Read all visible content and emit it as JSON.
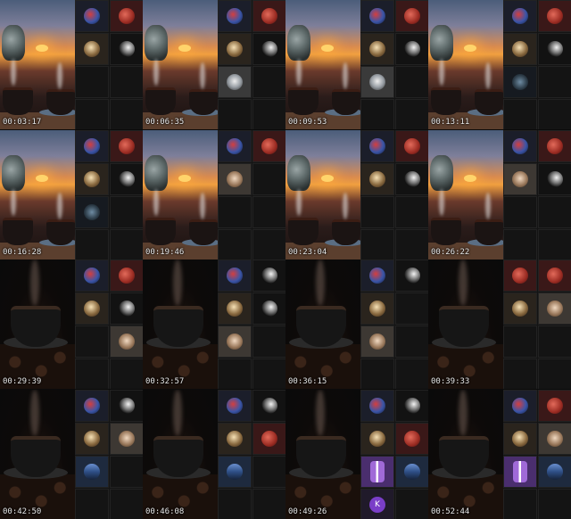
{
  "frames": [
    {
      "timestamp": "00:03:17",
      "scene": "sunset",
      "tiles": [
        "t-blue",
        "t-red",
        "t-gold",
        "t-moon",
        "t-empty",
        "t-empty",
        "t-empty",
        "t-empty"
      ],
      "icons": [
        "avatar-icon",
        "avatar-icon",
        "avatar-icon",
        "avatar-icon",
        "",
        "",
        "",
        ""
      ],
      "letters": [
        "",
        "",
        "",
        "",
        "",
        "",
        "",
        ""
      ]
    },
    {
      "timestamp": "00:06:35",
      "scene": "sunset",
      "tiles": [
        "t-blue",
        "t-red",
        "t-gold",
        "t-moon",
        "t-dome",
        "t-empty",
        "t-empty",
        "t-empty"
      ],
      "icons": [
        "avatar-icon",
        "avatar-icon",
        "avatar-icon",
        "avatar-icon",
        "avatar-icon",
        "",
        "",
        ""
      ],
      "letters": [
        "",
        "",
        "",
        "",
        "",
        "",
        "",
        ""
      ]
    },
    {
      "timestamp": "00:09:53",
      "scene": "sunset",
      "tiles": [
        "t-blue",
        "t-red",
        "t-gold",
        "t-moon",
        "t-dome",
        "t-empty",
        "t-empty",
        "t-empty"
      ],
      "icons": [
        "avatar-icon",
        "avatar-icon",
        "avatar-icon",
        "avatar-icon",
        "avatar-icon",
        "",
        "",
        ""
      ],
      "letters": [
        "",
        "",
        "",
        "",
        "",
        "",
        "",
        ""
      ]
    },
    {
      "timestamp": "00:13:11",
      "scene": "sunset",
      "tiles": [
        "t-blue",
        "t-red",
        "t-gold",
        "t-moon",
        "t-night",
        "t-empty",
        "t-empty",
        "t-empty"
      ],
      "icons": [
        "avatar-icon",
        "avatar-icon",
        "avatar-icon",
        "avatar-icon",
        "avatar-icon",
        "",
        "",
        ""
      ],
      "letters": [
        "",
        "",
        "",
        "",
        "",
        "",
        "",
        ""
      ]
    },
    {
      "timestamp": "00:16:28",
      "scene": "sunset",
      "tiles": [
        "t-blue",
        "t-red",
        "t-gold",
        "t-moon",
        "t-night",
        "t-empty",
        "t-empty",
        "t-empty"
      ],
      "icons": [
        "avatar-icon",
        "avatar-icon",
        "avatar-icon",
        "avatar-icon",
        "avatar-icon",
        "",
        "",
        ""
      ],
      "letters": [
        "",
        "",
        "",
        "",
        "",
        "",
        "",
        ""
      ]
    },
    {
      "timestamp": "00:19:46",
      "scene": "sunset",
      "tiles": [
        "t-blue",
        "t-red",
        "t-face",
        "t-empty",
        "t-empty",
        "t-empty",
        "t-empty",
        "t-empty"
      ],
      "icons": [
        "avatar-icon",
        "avatar-icon",
        "avatar-icon",
        "",
        "",
        "",
        "",
        ""
      ],
      "letters": [
        "",
        "",
        "",
        "",
        "",
        "",
        "",
        ""
      ]
    },
    {
      "timestamp": "00:23:04",
      "scene": "sunset",
      "tiles": [
        "t-blue",
        "t-red",
        "t-gold",
        "t-moon",
        "t-empty",
        "t-empty",
        "t-empty",
        "t-empty"
      ],
      "icons": [
        "avatar-icon",
        "avatar-icon",
        "avatar-icon",
        "avatar-icon",
        "",
        "",
        "",
        ""
      ],
      "letters": [
        "",
        "",
        "",
        "",
        "",
        "",
        "",
        ""
      ]
    },
    {
      "timestamp": "00:26:22",
      "scene": "sunset",
      "tiles": [
        "t-blue",
        "t-red",
        "t-face",
        "t-moon",
        "t-empty",
        "t-empty",
        "t-empty",
        "t-empty"
      ],
      "icons": [
        "avatar-icon",
        "avatar-icon",
        "avatar-icon",
        "avatar-icon",
        "",
        "",
        "",
        ""
      ],
      "letters": [
        "",
        "",
        "",
        "",
        "",
        "",
        "",
        ""
      ]
    },
    {
      "timestamp": "00:29:39",
      "scene": "coffee",
      "tiles": [
        "t-blue",
        "t-red",
        "t-gold",
        "t-moon",
        "t-empty",
        "t-face",
        "t-empty",
        "t-empty"
      ],
      "icons": [
        "avatar-icon",
        "avatar-icon",
        "avatar-icon",
        "avatar-icon",
        "",
        "avatar-icon",
        "",
        ""
      ],
      "letters": [
        "",
        "",
        "",
        "",
        "",
        "",
        "",
        ""
      ]
    },
    {
      "timestamp": "00:32:57",
      "scene": "coffee",
      "tiles": [
        "t-blue",
        "t-moon",
        "t-gold",
        "t-moon",
        "t-face",
        "t-empty",
        "t-empty",
        "t-empty"
      ],
      "icons": [
        "avatar-icon",
        "avatar-icon",
        "avatar-icon",
        "avatar-icon",
        "avatar-icon",
        "",
        "",
        ""
      ],
      "letters": [
        "",
        "",
        "",
        "",
        "",
        "",
        "",
        ""
      ]
    },
    {
      "timestamp": "00:36:15",
      "scene": "coffee",
      "tiles": [
        "t-blue",
        "t-moon",
        "t-gold",
        "t-empty",
        "t-face",
        "t-empty",
        "t-empty",
        "t-empty"
      ],
      "icons": [
        "avatar-icon",
        "avatar-icon",
        "avatar-icon",
        "",
        "avatar-icon",
        "",
        "",
        ""
      ],
      "letters": [
        "",
        "",
        "",
        "",
        "",
        "",
        "",
        ""
      ]
    },
    {
      "timestamp": "00:39:33",
      "scene": "coffee",
      "tiles": [
        "t-red",
        "t-red",
        "t-gold",
        "t-face",
        "t-empty",
        "t-empty",
        "t-empty",
        "t-empty"
      ],
      "icons": [
        "avatar-icon",
        "avatar-icon",
        "avatar-icon",
        "avatar-icon",
        "",
        "",
        "",
        ""
      ],
      "letters": [
        "",
        "",
        "",
        "",
        "",
        "",
        "",
        ""
      ]
    },
    {
      "timestamp": "00:42:50",
      "scene": "coffee",
      "tiles": [
        "t-blue",
        "t-moon",
        "t-gold",
        "t-face",
        "t-sea",
        "t-empty",
        "t-empty",
        "t-empty"
      ],
      "icons": [
        "avatar-icon",
        "avatar-icon",
        "avatar-icon",
        "avatar-icon",
        "avatar-icon",
        "",
        "",
        ""
      ],
      "letters": [
        "",
        "",
        "",
        "",
        "",
        "",
        "",
        ""
      ]
    },
    {
      "timestamp": "00:46:08",
      "scene": "coffee",
      "tiles": [
        "t-blue",
        "t-moon",
        "t-gold",
        "t-red",
        "t-sea",
        "t-empty",
        "t-empty",
        "t-empty"
      ],
      "icons": [
        "avatar-icon",
        "avatar-icon",
        "avatar-icon",
        "avatar-icon",
        "avatar-icon",
        "",
        "",
        ""
      ],
      "letters": [
        "",
        "",
        "",
        "",
        "",
        "",
        "",
        ""
      ]
    },
    {
      "timestamp": "00:49:26",
      "scene": "coffee",
      "tiles": [
        "t-blue",
        "t-moon",
        "t-gold",
        "t-red",
        "t-violet",
        "t-sea",
        "t-letter",
        "t-empty"
      ],
      "icons": [
        "avatar-icon",
        "avatar-icon",
        "avatar-icon",
        "avatar-icon",
        "avatar-icon",
        "avatar-icon",
        "avatar-icon",
        ""
      ],
      "letters": [
        "",
        "",
        "",
        "",
        "",
        "",
        "K",
        ""
      ]
    },
    {
      "timestamp": "00:52:44",
      "scene": "coffee",
      "tiles": [
        "t-blue",
        "t-red",
        "t-gold",
        "t-face",
        "t-violet",
        "t-sea",
        "t-empty",
        "t-empty"
      ],
      "icons": [
        "avatar-icon",
        "avatar-icon",
        "avatar-icon",
        "avatar-icon",
        "avatar-icon",
        "avatar-icon",
        "",
        ""
      ],
      "letters": [
        "",
        "",
        "",
        "",
        "",
        "",
        "",
        ""
      ]
    }
  ]
}
